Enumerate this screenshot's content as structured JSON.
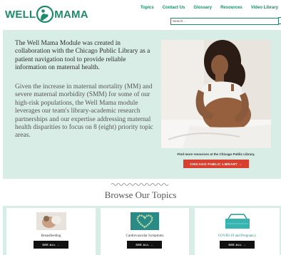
{
  "header": {
    "logo_left": "WELL",
    "logo_right": "MAMA",
    "nav": [
      "Topics",
      "Contact Us",
      "Glossary",
      "Resources",
      "Video Library"
    ],
    "search_placeholder": "Search..."
  },
  "hero": {
    "intro": "The Well Mama Module was created in collaboration with the Chicago Public Library as a patient navigation tool to provide reliable information on maternal health.",
    "details": "Given the increase in maternal mortality (MM) and severe maternal morbidity (SMM) for some of our high-risk populations, the Well Mama module leverages our team's library-academic research partnerships and our expertise addressing maternal health disparities to focus on 8 (eight) priority topic areas.",
    "resources_text": "Find more resources at the Chicago Public Library.",
    "library_button": "CHICAGO PUBLIC LIBRARY  →"
  },
  "browse": {
    "title": "Browse Our Topics",
    "cards": [
      {
        "label": "Breastfeeding",
        "button": "SEE ALL  →"
      },
      {
        "label": "Cardiovascular Symptoms",
        "button": "SEE ALL  →"
      },
      {
        "label": "COVID-19 and Pregnancy",
        "button": "SEE ALL  →"
      }
    ]
  },
  "colors": {
    "brand_green": "#1e8a6a",
    "hero_bg": "#d8ede6",
    "library_red": "#d8412f",
    "button_black": "#111111"
  }
}
